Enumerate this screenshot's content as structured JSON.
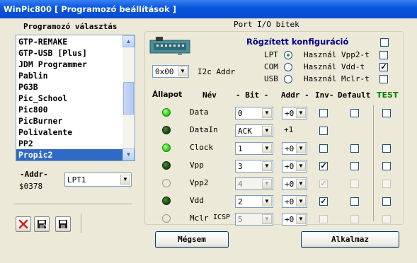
{
  "window": {
    "title": "WinPic800 [ Programozó beállítások ]"
  },
  "programmer_select": {
    "heading": "Programozó választás",
    "items": [
      "GTP-REMAKE",
      "GTP-USB [Plus]",
      "JDM Programmer",
      "Pablin",
      "PG3B",
      "Pic_School",
      "Pic800",
      "PicBurner",
      "Polivalente",
      "PP2",
      "Propic2"
    ],
    "selected": "Propic2",
    "addr_label": "-Addr-",
    "addr_value": "$0378",
    "port_value": "LPT1"
  },
  "port_io": {
    "heading": "Port I/O bitek",
    "fixed_config": "Rögzített konfiguráció",
    "i2c_value": "0x00",
    "i2c_label": "I2c Addr",
    "ports": [
      {
        "label": "LPT",
        "selected": true
      },
      {
        "label": "COM",
        "selected": false
      },
      {
        "label": "USB",
        "selected": false
      }
    ],
    "options": [
      {
        "label": "Használ Vpp2-t",
        "checked": false
      },
      {
        "label": "Használ Vdd-t",
        "checked": true
      },
      {
        "label": "Használ Mclr-t",
        "checked": false
      }
    ],
    "columns": {
      "state": "Állapot",
      "name": "Név",
      "bit": "- Bit -",
      "addr": "Addr -",
      "inv": "Inv-",
      "default": "Default",
      "test": "TEST"
    },
    "rows": [
      {
        "name": "Data",
        "led": "bright",
        "bit": "0",
        "addr": "+0",
        "inv": false,
        "default": false,
        "test": false,
        "disabled": false
      },
      {
        "name": "DataIn",
        "led": "dark",
        "bit": "ACK",
        "addr": "+1",
        "inv": false,
        "default": null,
        "test": null,
        "disabled": false
      },
      {
        "name": "Clock",
        "led": "bright",
        "bit": "1",
        "addr": "+0",
        "inv": false,
        "default": false,
        "test": false,
        "disabled": false
      },
      {
        "name": "Vpp",
        "led": "dark",
        "bit": "3",
        "addr": "+0",
        "inv": true,
        "default": false,
        "test": false,
        "disabled": false
      },
      {
        "name": "Vpp2",
        "led": "off",
        "bit": "4",
        "addr": "+0",
        "inv": true,
        "default": false,
        "test": false,
        "disabled": true
      },
      {
        "name": "Vdd",
        "led": "dark",
        "bit": "2",
        "addr": "+0",
        "inv": true,
        "default": false,
        "test": false,
        "disabled": false
      },
      {
        "name": "Mclr",
        "name_suffix": "ICSP",
        "led": "off",
        "bit": "5",
        "addr": "+0",
        "inv": false,
        "default": false,
        "test": false,
        "disabled": true
      }
    ],
    "cancel_label": "Mégsem",
    "apply_label": "Alkalmaz"
  },
  "colors": {
    "title_bar": "#0a58e0",
    "selection": "#316ac5",
    "heading_blue": "#00008b",
    "test_green": "#008000"
  }
}
